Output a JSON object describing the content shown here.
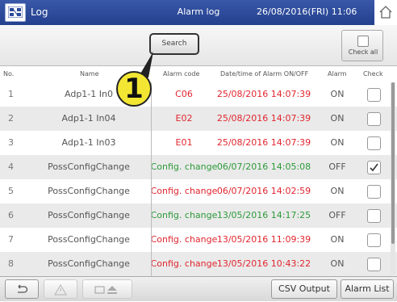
{
  "header": {
    "log_label": "Log",
    "title": "Alarm log",
    "datetime": "26/08/2016(FRI) 11:06"
  },
  "toolbar": {
    "search_label": "Search",
    "check_all_label": "Check all"
  },
  "table": {
    "columns": [
      "No.",
      "Name",
      "Alarm code",
      "Date/time of Alarm ON/OFF",
      "Alarm",
      "Check"
    ],
    "rows": [
      {
        "no": "1",
        "name": "Adp1-1 In0",
        "code": "C06",
        "code_color": "#e0262f",
        "datetime": "25/08/2016 14:07:39",
        "dt_color": "#e0262f",
        "alarm": "ON",
        "checked": false
      },
      {
        "no": "2",
        "name": "Adp1-1 In04",
        "code": "E02",
        "code_color": "#e0262f",
        "datetime": "25/08/2016 14:07:39",
        "dt_color": "#e0262f",
        "alarm": "ON",
        "checked": false
      },
      {
        "no": "3",
        "name": "Adp1-1 In03",
        "code": "E01",
        "code_color": "#e0262f",
        "datetime": "25/08/2016 14:07:39",
        "dt_color": "#e0262f",
        "alarm": "ON",
        "checked": false
      },
      {
        "no": "4",
        "name": "PossConfigChange",
        "code": "Config. change",
        "code_color": "#2e9a3a",
        "datetime": "06/07/2016 14:05:08",
        "dt_color": "#2e9a3a",
        "alarm": "OFF",
        "checked": true
      },
      {
        "no": "5",
        "name": "PossConfigChange",
        "code": "Config. change",
        "code_color": "#e0262f",
        "datetime": "06/07/2016 14:02:59",
        "dt_color": "#e0262f",
        "alarm": "ON",
        "checked": false
      },
      {
        "no": "6",
        "name": "PossConfigChange",
        "code": "Config. change",
        "code_color": "#2e9a3a",
        "datetime": "13/05/2016 14:17:25",
        "dt_color": "#2e9a3a",
        "alarm": "OFF",
        "checked": false
      },
      {
        "no": "7",
        "name": "PossConfigChange",
        "code": "Config. change",
        "code_color": "#e0262f",
        "datetime": "13/05/2016 11:09:39",
        "dt_color": "#e0262f",
        "alarm": "ON",
        "checked": false
      },
      {
        "no": "8",
        "name": "PossConfigChange",
        "code": "Config. change",
        "code_color": "#e0262f",
        "datetime": "13/05/2016 10:43:22",
        "dt_color": "#e0262f",
        "alarm": "ON",
        "checked": false
      }
    ]
  },
  "callout": {
    "number": "1"
  },
  "footer": {
    "back_icon": "back-arrow-icon",
    "warning_icon": "warning-icon",
    "media_icon": "eject-icon",
    "csv_output_label": "CSV Output",
    "alarm_list_label": "Alarm List"
  },
  "colors": {
    "header_bg": "#2c4a9c",
    "alarm_on": "#e0262f",
    "alarm_off": "#2e9a3a",
    "callout": "#f3e633"
  }
}
